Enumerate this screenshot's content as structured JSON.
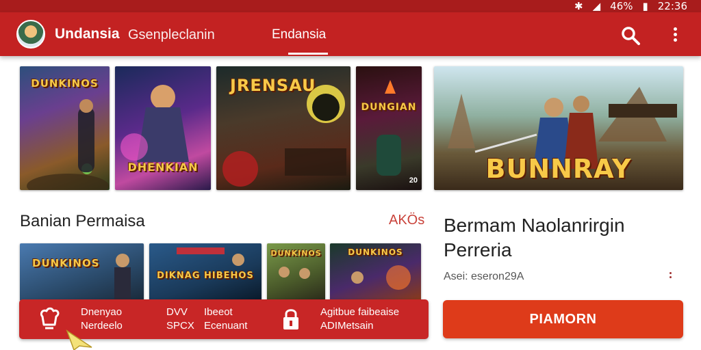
{
  "status_bar": {
    "bluetooth_icon": "bluetooth-icon",
    "battery_percent": "46%",
    "time": "22:36"
  },
  "app_bar": {
    "title": "Undansia",
    "subtitle": "Gsenpleclanin",
    "active_tab": "Endansia",
    "search_icon": "search-icon",
    "menu_icon": "more-vert-icon"
  },
  "hero_banner": {
    "logo_text": "BUNNRAY"
  },
  "top_cards": [
    {
      "logo_text": "DUNKINOS",
      "badge": ""
    },
    {
      "logo_text": "DHENKIAN",
      "badge": ""
    },
    {
      "logo_text": "JRENSAU",
      "badge": ""
    },
    {
      "logo_text": "DUNGIAN",
      "badge": "20"
    }
  ],
  "section": {
    "title": "Banian Permaisa",
    "more_label": "AKÖs"
  },
  "bottom_cards": [
    {
      "logo_text": "DUNKINOS"
    },
    {
      "logo_text": "DIKNAG HIBEHOS"
    },
    {
      "logo_text": "DUNKINOS"
    },
    {
      "logo_text": "DUNKINOS"
    }
  ],
  "detail": {
    "title": "Bermam Naolanrirgin Perreria",
    "meta": "Asei: eseron29A"
  },
  "bottom_bar": {
    "item1_line1": "Dnenyao",
    "item1_line2": "Nerdeelo",
    "item2_line1": "DVV",
    "item2_line2": "SPCX",
    "item3_line1": "Ibeeot",
    "item3_line2": "Ecenuant",
    "item4_line1": "Agitbue faibeaise",
    "item4_line2": "ADIMetsain"
  },
  "play_button": {
    "label": "PIAMORN"
  },
  "colors": {
    "primary_red": "#c32222",
    "status_red": "#a81c1c",
    "button_orange_red": "#de3b1a",
    "logo_gold": "#f7c948"
  }
}
